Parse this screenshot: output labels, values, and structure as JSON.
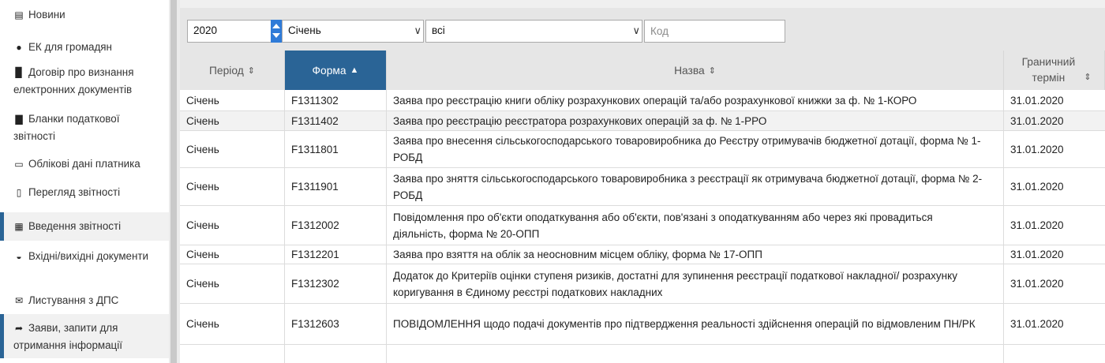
{
  "sidebar": {
    "items": [
      {
        "icon": "newspaper-icon",
        "glyph": "▤",
        "label": "Новини"
      },
      {
        "icon": "user-icon",
        "glyph": "●",
        "label": "ЕК для громадян"
      },
      {
        "icon": "book-icon",
        "glyph": "▉",
        "label": "Договір про визнання електронних документів"
      },
      {
        "icon": "file-icon",
        "glyph": "▇",
        "label": "Бланки податкової звітності"
      },
      {
        "icon": "id-card-icon",
        "glyph": "▭",
        "label": "Облікові дані платника"
      },
      {
        "icon": "document-icon",
        "glyph": "▯",
        "label": "Перегляд звітності"
      },
      {
        "icon": "calendar-icon",
        "glyph": "▦",
        "label": "Введення звітності"
      },
      {
        "icon": "inbox-icon",
        "glyph": "◒",
        "label": "Вхідні/вихідні документи"
      },
      {
        "icon": "envelope-icon",
        "glyph": "✉",
        "label": "Листування з ДПС"
      },
      {
        "icon": "share-icon",
        "glyph": "➦",
        "label": "Заяви, запити для отримання інформації"
      }
    ]
  },
  "filters": {
    "year": "2020",
    "month": "Січень",
    "type": "всі",
    "code_placeholder": "Код"
  },
  "table": {
    "headers": {
      "period": "Період",
      "form": "Форма",
      "name": "Назва",
      "term": "Граничний термін"
    },
    "sort_arrows": {
      "unsorted": "⇕",
      "asc": "▲"
    },
    "rows": [
      {
        "period": "Січень",
        "form": "F1311302",
        "name": "Заява про реєстрацію книги обліку розрахункових операцій та/або розрахункової книжки за ф. № 1-КОРО",
        "term": "31.01.2020"
      },
      {
        "period": "Січень",
        "form": "F1311402",
        "name": "Заява про реєстрацію реєстратора розрахункових операцій за ф. № 1-РРО",
        "term": "31.01.2020"
      },
      {
        "period": "Січень",
        "form": "F1311801",
        "name": "Заява про внесення сільськогосподарського товаровиробника до Реєстру отримувачів бюджетної дотації, форма № 1-РОБД",
        "term": "31.01.2020"
      },
      {
        "period": "Січень",
        "form": "F1311901",
        "name": "Заява про зняття сільськогосподарського товаровиробника з реєстрації як отримувача бюджетної дотації, форма № 2-РОБД",
        "term": "31.01.2020"
      },
      {
        "period": "Січень",
        "form": "F1312002",
        "name": "Повідомлення про об'єкти оподаткування або об'єкти, пов'язані з оподаткуванням або через які провадиться діяльність, форма № 20-ОПП",
        "term": "31.01.2020"
      },
      {
        "period": "Січень",
        "form": "F1312201",
        "name": "Заява про взяття на облік за неосновним місцем обліку, форма № 17-ОПП",
        "term": "31.01.2020"
      },
      {
        "period": "Січень",
        "form": "F1312302",
        "name": "Додаток до Критеріїв оцінки ступеня ризиків, достатні для зупинення реєстрації податкової накладної/ розрахунку коригування в Єдиному реєстрі податкових накладних",
        "term": "31.01.2020"
      },
      {
        "period": "Січень",
        "form": "F1312603",
        "name": "ПОВІДОМЛЕННЯ щодо подачі документів про підтвердження реальності здійснення операцій по відмовленим ПН/РК",
        "term": "31.01.2020"
      }
    ]
  },
  "colors": {
    "accent": "#2a6496",
    "header_bg": "#e6e6e6",
    "row_alt": "#f2f2f2"
  }
}
